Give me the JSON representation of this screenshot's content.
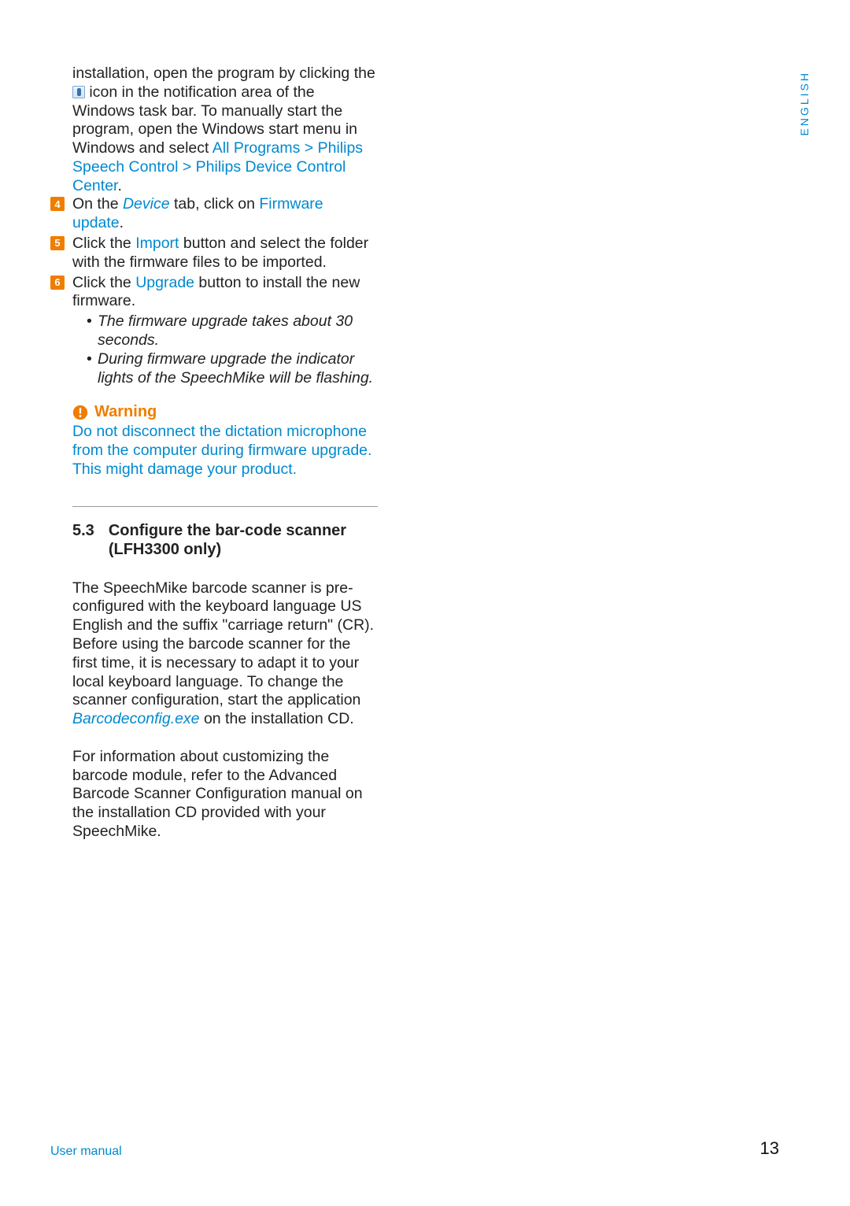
{
  "lang_tab": "ENGLISH",
  "step_intro": {
    "part1": "installation, open the program by clicking the ",
    "part2": " icon in the notification area of the Windows task bar. To manually start the program, open the Windows start menu in Windows and select ",
    "menu_path": "All Programs > Philips Speech Control > Philips Device Control Center",
    "period": "."
  },
  "steps": {
    "s4": {
      "num": "4",
      "t1": "On the ",
      "device": "Device",
      "t2": " tab, click on ",
      "fw": "Firmware update",
      "t3": "."
    },
    "s5": {
      "num": "5",
      "t1": "Click the ",
      "imp": "Import",
      "t2": " button and select the folder with the firmware files to be imported."
    },
    "s6": {
      "num": "6",
      "t1": "Click the ",
      "upg": "Upgrade",
      "t2": " button to install the new firmware."
    }
  },
  "bullets": {
    "b1": "The firmware upgrade takes about 30 seconds.",
    "b2": "During firmware upgrade the indicator lights of the SpeechMike will be flashing."
  },
  "warning": {
    "title": "Warning",
    "text": "Do not disconnect the dictation microphone from the computer during firmware upgrade. This might damage your product."
  },
  "section": {
    "num": "5.3",
    "title": "Configure the bar-code scanner (LFH3300 only)"
  },
  "para1": {
    "t1": "The SpeechMike barcode scanner is pre-configured with the keyboard language US English and the suffix \"carriage return\" (CR). Before using the barcode scanner for the first time, it is necessary to adapt it to your local keyboard language. To change the scanner configuration, start the application ",
    "app": "Barcodeconfig.exe",
    "t2": " on the installation CD."
  },
  "para2": "For information about customizing the barcode module, refer to the Advanced Barcode Scanner Configuration manual on the installation CD provided with your SpeechMike.",
  "footer": {
    "left": "User manual",
    "right": "13"
  }
}
